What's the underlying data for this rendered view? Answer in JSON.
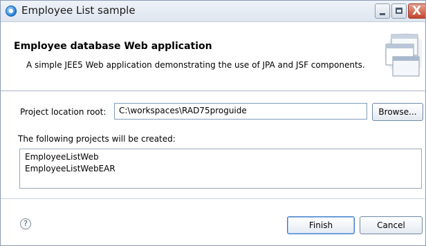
{
  "window": {
    "title": "Employee List sample",
    "close_glyph": "X"
  },
  "header": {
    "title": "Employee database Web application",
    "description": "A simple JEE5 Web application demonstrating the use of JPA and JSF components."
  },
  "form": {
    "root_label": "Project location root:",
    "root_value": "C:\\workspaces\\RAD75proguide",
    "browse_label": "Browse...",
    "projects_label": "The following projects will be created:",
    "projects": [
      "EmployeeListWeb",
      "EmployeeListWebEAR"
    ]
  },
  "footer": {
    "help_glyph": "?",
    "finish_label": "Finish",
    "cancel_label": "Cancel"
  },
  "icons": {
    "app": "eclipse-icon",
    "banner": "wizard-windows-icon",
    "help": "help-icon"
  },
  "colors": {
    "close_button": "#c3452e",
    "default_button_border": "#3d78c7"
  }
}
